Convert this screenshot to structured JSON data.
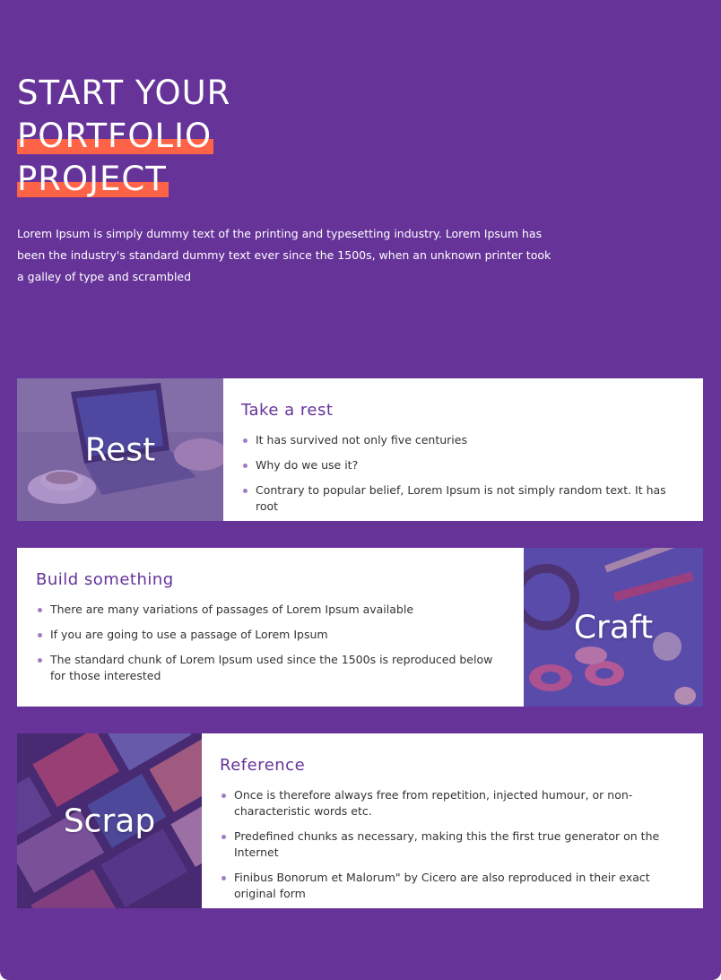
{
  "hero": {
    "title_line1": "START YOUR",
    "title_line2": "PORTFOLIO",
    "title_line3": "PROJECT",
    "intro": "Lorem Ipsum is simply dummy text of the printing and typesetting industry. Lorem Ipsum has been the industry's standard dummy text ever since the 1500s, when an unknown printer took a galley of type and scrambled"
  },
  "colors": {
    "background": "#663399",
    "highlight": "#ff6347",
    "heading": "#663399",
    "bullet": "#a07cc5"
  },
  "cards": [
    {
      "image_label": "Rest",
      "title": "Take a rest",
      "items": [
        "It has survived not only five centuries",
        "Why do we use it?",
        "Contrary to popular belief, Lorem Ipsum is not simply random text. It has root"
      ]
    },
    {
      "image_label": "Craft",
      "title": "Build something",
      "items": [
        "There are many variations of passages of Lorem Ipsum available",
        "If you are going to use a passage of Lorem Ipsum",
        "The standard chunk of Lorem Ipsum used since the 1500s is reproduced below for those interested"
      ]
    },
    {
      "image_label": "Scrap",
      "title": "Reference",
      "items": [
        "Once is therefore always free from repetition, injected humour, or non-characteristic words etc.",
        "Predefined chunks as necessary, making this the first true generator on the Internet",
        "Finibus Bonorum et Malorum\" by Cicero are also reproduced in their exact original form"
      ]
    }
  ]
}
